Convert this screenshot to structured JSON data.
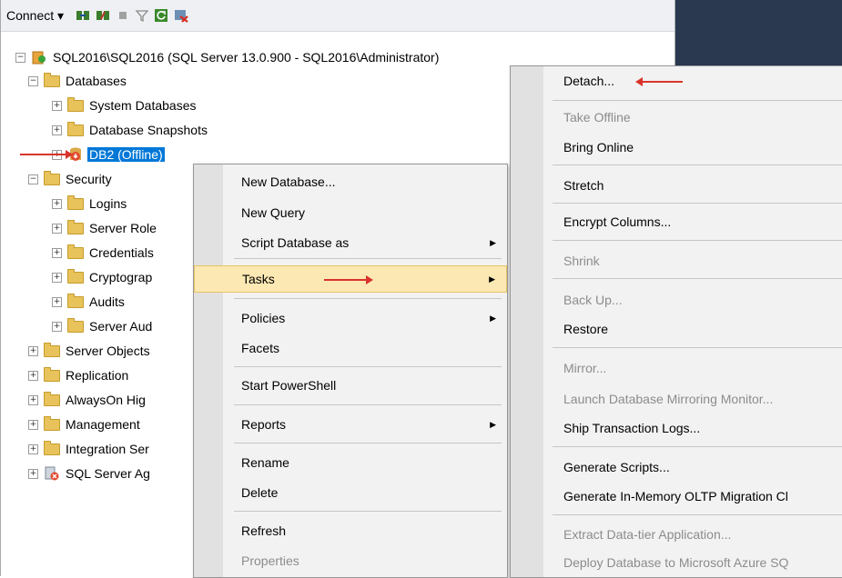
{
  "toolbar": {
    "connect_label": "Connect",
    "dropdown_glyph": "▾"
  },
  "tree": {
    "server": "SQL2016\\SQL2016 (SQL Server 13.0.900 - SQL2016\\Administrator)",
    "databases": "Databases",
    "system_databases": "System Databases",
    "database_snapshots": "Database Snapshots",
    "db2": "DB2 (Offline)",
    "security": "Security",
    "logins": "Logins",
    "server_roles": "Server Role",
    "credentials": "Credentials",
    "cryptographic": "Cryptograp",
    "audits": "Audits",
    "server_audit": "Server Aud",
    "server_objects": "Server Objects",
    "replication": "Replication",
    "alwayson": "AlwaysOn Hig",
    "management": "Management",
    "integration": "Integration Ser",
    "sql_agent": "SQL Server Ag"
  },
  "context_menu": {
    "new_database": "New Database...",
    "new_query": "New Query",
    "script_database_as": "Script Database as",
    "tasks": "Tasks",
    "policies": "Policies",
    "facets": "Facets",
    "start_powershell": "Start PowerShell",
    "reports": "Reports",
    "rename": "Rename",
    "delete": "Delete",
    "refresh": "Refresh",
    "properties": "Properties"
  },
  "tasks_menu": {
    "detach": "Detach...",
    "take_offline": "Take Offline",
    "bring_online": "Bring Online",
    "stretch": "Stretch",
    "encrypt_columns": "Encrypt Columns...",
    "shrink": "Shrink",
    "back_up": "Back Up...",
    "restore": "Restore",
    "mirror": "Mirror...",
    "launch_mirroring_monitor": "Launch Database Mirroring Monitor...",
    "ship_transaction_logs": "Ship Transaction Logs...",
    "generate_scripts": "Generate Scripts...",
    "generate_inmemory": "Generate In-Memory OLTP Migration Cl",
    "extract_datatier": "Extract Data-tier Application...",
    "deploy_azure": "Deploy Database to Microsoft Azure SQ"
  },
  "glyphs": {
    "expand": "+",
    "collapse": "−",
    "submenu": "▶"
  },
  "colors": {
    "selection": "#0078d7",
    "annotation_arrow": "#d9342b",
    "highlight": "#fce8b3"
  }
}
